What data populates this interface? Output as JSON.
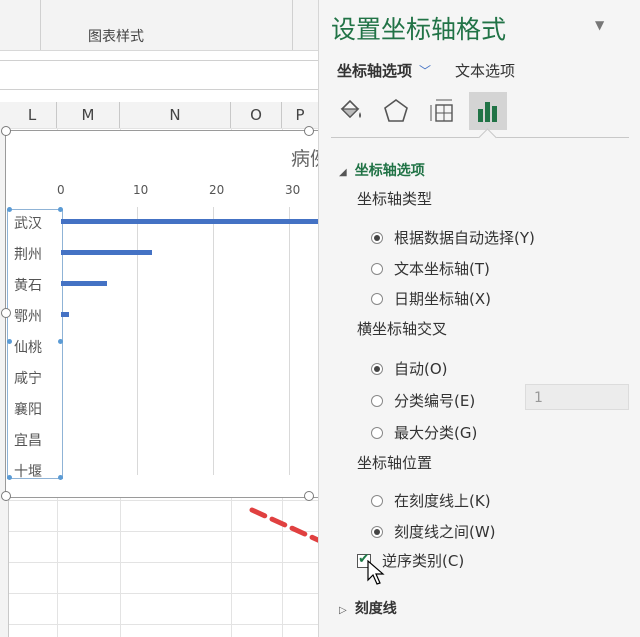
{
  "ribbon": {
    "label": "图表样式"
  },
  "sheet": {
    "columns": [
      "L",
      "M",
      "N",
      "O",
      "P"
    ]
  },
  "chart": {
    "title": "病例",
    "x_ticks": [
      "0",
      "10",
      "20",
      "30"
    ]
  },
  "chart_data": {
    "type": "bar",
    "orientation": "horizontal",
    "title": "病例",
    "categories": [
      "武汉",
      "荆州",
      "黄石",
      "鄂州",
      "仙桃",
      "咸宁",
      "襄阳",
      "宜昌",
      "十堰"
    ],
    "values": [
      34,
      12,
      6,
      1,
      0,
      0,
      0,
      0,
      0
    ],
    "xlim": [
      -5,
      34
    ],
    "x_ticks": [
      0,
      10,
      20,
      30
    ],
    "grid": true,
    "colors": {
      "bar": "#4472c4"
    }
  },
  "pane": {
    "title": "设置坐标轴格式",
    "tabs": {
      "axis_options": "坐标轴选项",
      "text_options": "文本选项"
    },
    "icons": [
      "paint-bucket-icon",
      "pentagon-icon",
      "size-properties-icon",
      "bar-chart-icon"
    ],
    "section_axis": "坐标轴选项",
    "axis_type": {
      "label": "坐标轴类型",
      "options": [
        "根据数据自动选择(Y)",
        "文本坐标轴(T)",
        "日期坐标轴(X)"
      ],
      "selected": 0
    },
    "cross": {
      "label": "横坐标轴交叉",
      "options": [
        "自动(O)",
        "分类编号(E)",
        "最大分类(G)"
      ],
      "selected": 0,
      "category_number": "1"
    },
    "position": {
      "label": "坐标轴位置",
      "options": [
        "在刻度线上(K)",
        "刻度线之间(W)"
      ],
      "selected": 1
    },
    "reverse": {
      "label": "逆序类别(C)",
      "checked": true
    },
    "section_ticks": "刻度线"
  },
  "colors": {
    "accent_green": "#217346",
    "bar_blue": "#4472c4",
    "arrow_red": "#e04040"
  }
}
